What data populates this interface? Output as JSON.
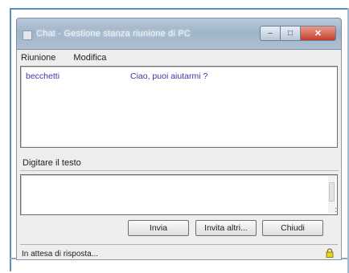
{
  "window": {
    "title": "Chat - Gestione stanza riunione di PC"
  },
  "titlebar_buttons": {
    "minimize_icon": "minimize-icon",
    "maximize_icon": "maximize-icon",
    "close_icon": "close-icon",
    "minimize_glyph": "–",
    "maximize_glyph": "□",
    "close_glyph": "✕"
  },
  "menu": {
    "items": [
      {
        "label": "Riunione"
      },
      {
        "label": "Modifica"
      }
    ]
  },
  "chat": {
    "messages": [
      {
        "user": "becchetti",
        "text": "Ciao, puoi aiutarmi ?"
      }
    ]
  },
  "input": {
    "label": "Digitare il testo",
    "value": "",
    "placeholder": ""
  },
  "buttons": {
    "send": "Invia",
    "invite": "Invita altri...",
    "close": "Chiudi"
  },
  "status": {
    "text": "In attesa di risposta...",
    "icon": "lock-icon",
    "icon_color": "#e8d21a"
  },
  "colors": {
    "message_text": "#3a36a8",
    "close_button": "#c4402e"
  }
}
